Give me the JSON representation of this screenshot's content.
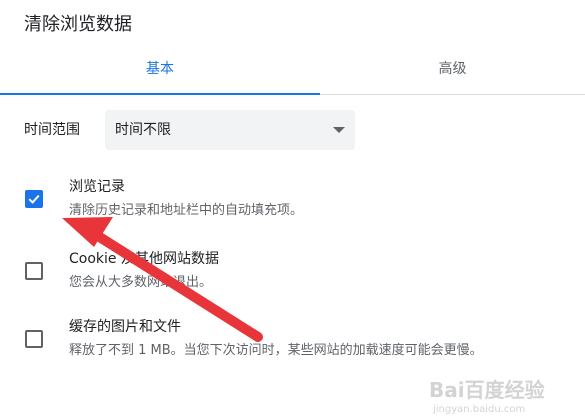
{
  "dialog": {
    "title": "清除浏览数据"
  },
  "tabs": [
    {
      "label": "基本",
      "active": true
    },
    {
      "label": "高级",
      "active": false
    }
  ],
  "time_range": {
    "label": "时间范围",
    "selected": "时间不限"
  },
  "options": [
    {
      "title": "浏览记录",
      "description": "清除历史记录和地址栏中的自动填充项。",
      "checked": true
    },
    {
      "title": "Cookie 及其他网站数据",
      "description": "您会从大多数网站退出。",
      "checked": false
    },
    {
      "title": "缓存的图片和文件",
      "description": "释放了不到 1 MB。当您下次访问时，某些网站的加载速度可能会更慢。",
      "checked": false
    }
  ],
  "colors": {
    "accent": "#1a73e8",
    "annotation_arrow": "#e8353a",
    "text_primary": "#202124",
    "text_secondary": "#5f6368"
  },
  "watermark": {
    "brand": "Bai百度经验",
    "url": "jingyan.baidu.com"
  }
}
